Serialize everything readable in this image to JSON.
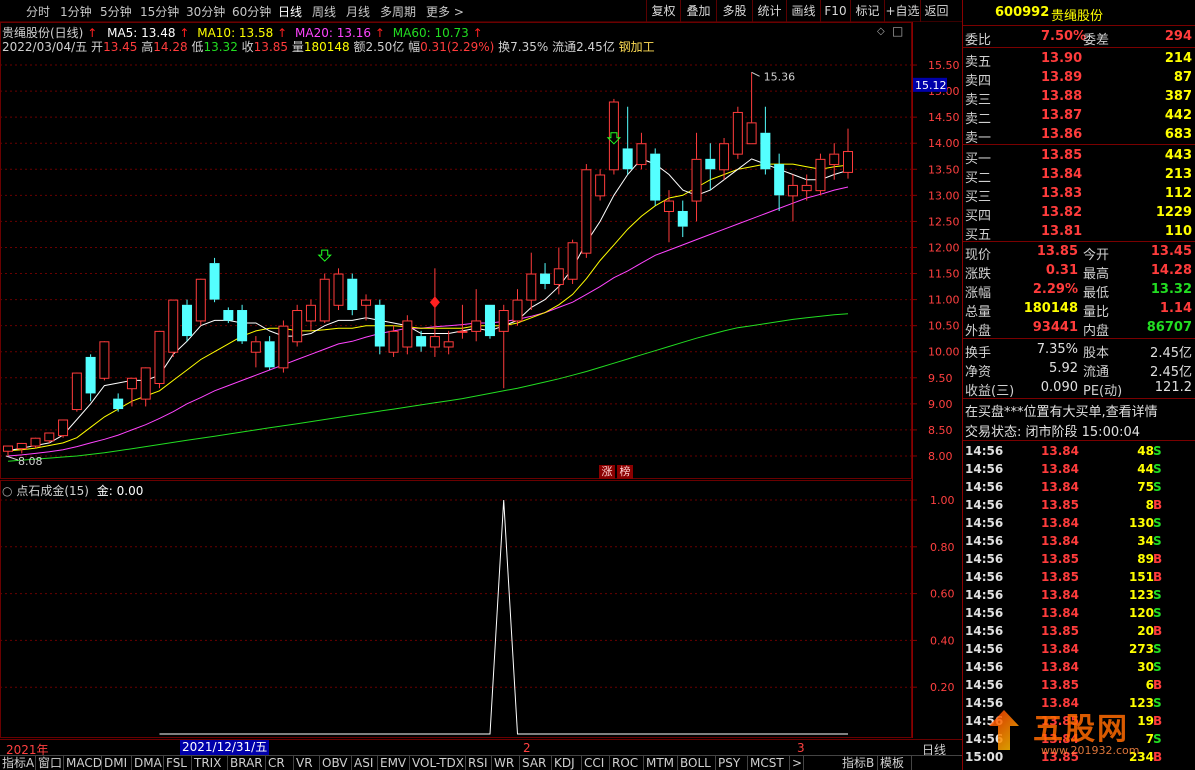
{
  "toolbar": {
    "periods": [
      "分时",
      "1分钟",
      "5分钟",
      "15分钟",
      "30分钟",
      "60分钟",
      "日线",
      "周线",
      "月线",
      "多周期",
      "更多 >"
    ],
    "active_period": "日线",
    "right_buttons": [
      "复权",
      "叠加",
      "多股",
      "统计",
      "画线",
      "F10",
      "标记",
      "+自选",
      "返回"
    ]
  },
  "info": {
    "stock_title": "贵绳股份(日线)",
    "ma5": "MA5: 13.48",
    "ma10": "MA10: 13.58",
    "ma20": "MA20: 13.16",
    "ma60": "MA60: 10.73",
    "date": "2022/03/04/五",
    "open_label": "开",
    "open": "13.45",
    "high_label": "高",
    "high": "14.28",
    "low_label": "低",
    "low": "13.32",
    "close_label": "收",
    "close": "13.85",
    "vol_label": "量",
    "vol": "180148",
    "amount_label": "额",
    "amount": "2.50亿",
    "range_label": "幅",
    "range": "0.31(2.29%)",
    "turnover": "换7.35%",
    "float": "流通2.45亿",
    "sector": "钢加工"
  },
  "colors": {
    "up": "#ff3c3c",
    "down": "#54ffff",
    "ma5": "#ffffff",
    "ma10": "#ffff00",
    "ma20": "#ff44ff",
    "ma60": "#22dd22",
    "grid": "#6a0000"
  },
  "main_axis": {
    "labels": [
      "15.50",
      "15.00",
      "14.50",
      "14.00",
      "13.50",
      "13.00",
      "12.50",
      "12.00",
      "11.50",
      "11.00",
      "10.50",
      "10.00",
      "9.50",
      "9.00",
      "8.50",
      "8.00"
    ],
    "current_price": "15.12",
    "high_mark": "15.36",
    "low_mark": "8.08",
    "min": 7.75,
    "max": 15.75
  },
  "badges": {
    "zhang": "涨",
    "bang": "榜"
  },
  "indicator": {
    "title": "点石成金(15)",
    "value_text": "金: 0.00",
    "axis": [
      "1.00",
      "0.80",
      "0.60",
      "0.40",
      "0.20"
    ]
  },
  "date_axis": {
    "year": "2021年",
    "selected_date": "2021/12/31/五",
    "m2": "2",
    "m3": "3",
    "period": "日线"
  },
  "candles": [
    [
      8.1,
      8.2,
      8.0,
      8.08
    ],
    [
      8.15,
      8.25,
      8.05,
      8.22
    ],
    [
      8.2,
      8.35,
      8.15,
      8.3
    ],
    [
      8.3,
      8.45,
      8.25,
      8.42
    ],
    [
      8.4,
      8.7,
      8.35,
      8.65
    ],
    [
      8.9,
      9.6,
      8.85,
      9.55
    ],
    [
      9.9,
      9.2,
      9.05,
      9.95
    ],
    [
      9.5,
      10.2,
      9.45,
      10.15
    ],
    [
      9.1,
      8.9,
      8.85,
      9.2
    ],
    [
      9.3,
      9.5,
      8.95,
      9.0
    ],
    [
      9.1,
      9.7,
      8.95,
      9.6
    ],
    [
      9.4,
      10.4,
      9.3,
      10.3
    ],
    [
      10.0,
      11.0,
      9.9,
      10.9
    ],
    [
      10.9,
      10.3,
      10.2,
      11.0
    ],
    [
      10.6,
      11.4,
      10.5,
      11.3
    ],
    [
      11.7,
      11.0,
      10.95,
      11.8
    ],
    [
      10.8,
      10.6,
      10.55,
      10.85
    ],
    [
      10.8,
      10.2,
      10.15,
      10.9
    ],
    [
      10.0,
      10.2,
      9.7,
      10.3
    ],
    [
      10.2,
      9.7,
      9.65,
      10.3
    ],
    [
      9.7,
      10.5,
      9.6,
      10.6
    ],
    [
      10.2,
      10.8,
      10.1,
      10.9
    ],
    [
      10.6,
      10.9,
      10.4,
      11.0
    ],
    [
      10.6,
      11.4,
      10.55,
      11.5
    ],
    [
      10.9,
      11.5,
      10.8,
      11.6
    ],
    [
      11.4,
      10.8,
      10.7,
      11.5
    ],
    [
      10.9,
      11.0,
      10.6,
      11.1
    ],
    [
      10.9,
      10.1,
      9.95,
      11.0
    ],
    [
      10.0,
      10.4,
      9.9,
      10.5
    ],
    [
      10.1,
      10.6,
      9.95,
      10.7
    ],
    [
      10.3,
      10.1,
      10.0,
      10.4
    ],
    [
      10.1,
      10.3,
      9.9,
      11.6
    ],
    [
      10.1,
      10.2,
      9.95,
      10.4
    ],
    [
      10.4,
      10.4,
      10.25,
      10.9
    ],
    [
      10.4,
      10.6,
      10.2,
      11.2
    ],
    [
      10.9,
      10.3,
      10.25,
      10.9
    ],
    [
      10.4,
      10.8,
      9.3,
      10.9
    ],
    [
      10.6,
      11.0,
      10.5,
      11.2
    ],
    [
      11.0,
      11.5,
      10.8,
      11.9
    ],
    [
      11.5,
      11.3,
      11.2,
      11.7
    ],
    [
      11.3,
      11.6,
      11.1,
      12.0
    ],
    [
      11.4,
      12.1,
      11.3,
      12.15
    ],
    [
      11.9,
      13.5,
      11.8,
      13.6
    ],
    [
      13.0,
      13.4,
      12.9,
      13.5
    ],
    [
      13.5,
      14.8,
      13.4,
      14.85
    ],
    [
      13.9,
      13.5,
      13.4,
      14.7
    ],
    [
      13.6,
      14.0,
      13.5,
      14.2
    ],
    [
      13.8,
      12.9,
      12.8,
      13.9
    ],
    [
      12.7,
      12.9,
      12.1,
      13.1
    ],
    [
      12.7,
      12.4,
      12.2,
      12.9
    ],
    [
      12.9,
      13.7,
      12.5,
      14.2
    ],
    [
      13.7,
      13.5,
      13.1,
      14.0
    ],
    [
      13.5,
      14.0,
      13.3,
      14.1
    ],
    [
      13.8,
      14.6,
      13.7,
      14.7
    ],
    [
      14.0,
      14.4,
      14.0,
      15.36
    ],
    [
      14.2,
      13.5,
      13.4,
      14.7
    ],
    [
      13.6,
      13.0,
      12.7,
      13.8
    ],
    [
      13.0,
      13.2,
      12.5,
      13.4
    ],
    [
      13.1,
      13.2,
      12.9,
      13.4
    ],
    [
      13.1,
      13.7,
      13.0,
      13.8
    ],
    [
      13.6,
      13.8,
      13.3,
      14.0
    ],
    [
      13.45,
      13.85,
      13.32,
      14.28
    ]
  ],
  "ma5": [
    8.1,
    8.15,
    8.2,
    8.25,
    8.4,
    8.7,
    9.0,
    9.35,
    9.4,
    9.45,
    9.45,
    9.55,
    9.95,
    10.2,
    10.5,
    10.6,
    10.6,
    10.55,
    10.55,
    10.4,
    10.3,
    10.3,
    10.35,
    10.5,
    10.6,
    10.6,
    10.65,
    10.6,
    10.55,
    10.5,
    10.35,
    10.35,
    10.35,
    10.4,
    10.45,
    10.4,
    10.5,
    10.6,
    10.85,
    11.0,
    11.25,
    11.6,
    12.1,
    12.5,
    13.0,
    13.4,
    13.7,
    13.6,
    13.4,
    13.1,
    13.0,
    13.1,
    13.3,
    13.5,
    13.7,
    13.6,
    13.5,
    13.4,
    13.3,
    13.3,
    13.4,
    13.48
  ],
  "ma10": [
    8.1,
    8.12,
    8.15,
    8.2,
    8.25,
    8.35,
    8.55,
    8.75,
    8.9,
    9.05,
    9.15,
    9.25,
    9.45,
    9.65,
    9.85,
    10.0,
    10.15,
    10.3,
    10.4,
    10.45,
    10.45,
    10.4,
    10.4,
    10.42,
    10.45,
    10.45,
    10.5,
    10.5,
    10.5,
    10.48,
    10.45,
    10.45,
    10.45,
    10.45,
    10.5,
    10.5,
    10.5,
    10.55,
    10.65,
    10.75,
    10.9,
    11.1,
    11.4,
    11.75,
    12.05,
    12.35,
    12.6,
    12.8,
    12.95,
    13.0,
    13.15,
    13.3,
    13.4,
    13.5,
    13.55,
    13.6,
    13.6,
    13.6,
    13.55,
    13.5,
    13.55,
    13.58
  ],
  "ma20": [
    8.0,
    8.02,
    8.05,
    8.08,
    8.12,
    8.18,
    8.25,
    8.32,
    8.4,
    8.5,
    8.6,
    8.72,
    8.85,
    9.0,
    9.12,
    9.25,
    9.35,
    9.45,
    9.55,
    9.65,
    9.75,
    9.85,
    9.95,
    10.05,
    10.15,
    10.2,
    10.28,
    10.35,
    10.4,
    10.45,
    10.45,
    10.48,
    10.5,
    10.52,
    10.55,
    10.55,
    10.58,
    10.62,
    10.68,
    10.75,
    10.85,
    10.95,
    11.1,
    11.25,
    11.42,
    11.55,
    11.7,
    11.85,
    11.95,
    12.05,
    12.15,
    12.25,
    12.35,
    12.45,
    12.55,
    12.65,
    12.75,
    12.85,
    12.95,
    13.02,
    13.1,
    13.16
  ],
  "ma60": [
    7.9,
    7.92,
    7.94,
    7.96,
    7.98,
    8.0,
    8.03,
    8.06,
    8.1,
    8.14,
    8.18,
    8.22,
    8.26,
    8.3,
    8.34,
    8.38,
    8.42,
    8.46,
    8.5,
    8.54,
    8.58,
    8.62,
    8.66,
    8.7,
    8.74,
    8.78,
    8.82,
    8.86,
    8.9,
    8.94,
    8.98,
    9.02,
    9.06,
    9.1,
    9.15,
    9.2,
    9.25,
    9.3,
    9.36,
    9.42,
    9.48,
    9.55,
    9.62,
    9.7,
    9.78,
    9.86,
    9.94,
    10.02,
    10.1,
    10.18,
    10.26,
    10.33,
    10.4,
    10.46,
    10.5,
    10.54,
    10.58,
    10.62,
    10.65,
    10.68,
    10.71,
    10.73
  ],
  "quote": {
    "code": "600992",
    "name": "贵绳股份",
    "weibi_label": "委比",
    "weibi": "7.50%",
    "weicha_label": "委差",
    "weicha": "294",
    "sell": [
      {
        "label": "卖五",
        "price": "13.90",
        "vol": "214"
      },
      {
        "label": "卖四",
        "price": "13.89",
        "vol": "87"
      },
      {
        "label": "卖三",
        "price": "13.88",
        "vol": "387"
      },
      {
        "label": "卖二",
        "price": "13.87",
        "vol": "442"
      },
      {
        "label": "卖一",
        "price": "13.86",
        "vol": "683"
      }
    ],
    "buy": [
      {
        "label": "买一",
        "price": "13.85",
        "vol": "443"
      },
      {
        "label": "买二",
        "price": "13.84",
        "vol": "213"
      },
      {
        "label": "买三",
        "price": "13.83",
        "vol": "112"
      },
      {
        "label": "买四",
        "price": "13.82",
        "vol": "1229"
      },
      {
        "label": "买五",
        "price": "13.81",
        "vol": "110"
      }
    ],
    "stats1": [
      {
        "l1": "现价",
        "v1": "13.85",
        "l2": "今开",
        "v2": "13.45",
        "c2": "#ff3c3c",
        "c1": "#ff3c3c"
      },
      {
        "l1": "涨跌",
        "v1": "0.31",
        "l2": "最高",
        "v2": "14.28",
        "c1": "#ff3c3c",
        "c2": "#ff3c3c"
      },
      {
        "l1": "涨幅",
        "v1": "2.29%",
        "l2": "最低",
        "v2": "13.32",
        "c1": "#ff3c3c",
        "c2": "#22dd22"
      },
      {
        "l1": "总量",
        "v1": "180148",
        "l2": "量比",
        "v2": "1.14",
        "c1": "#ffff00",
        "c2": "#ff3c3c"
      },
      {
        "l1": "外盘",
        "v1": "93441",
        "l2": "内盘",
        "v2": "86707",
        "c1": "#ff3c3c",
        "c2": "#22dd22"
      }
    ],
    "stats2": [
      {
        "l1": "换手",
        "v1": "7.35%",
        "l2": "股本",
        "v2": "2.45亿"
      },
      {
        "l1": "净资",
        "v1": "5.92",
        "l2": "流通",
        "v2": "2.45亿"
      },
      {
        "l1": "收益(三)",
        "v1": "0.090",
        "l2": "PE(动)",
        "v2": "121.2"
      }
    ],
    "notice": "在买盘***位置有大买单,查看详情",
    "trade_status": "交易状态: 闭市阶段 15:00:04"
  },
  "ticks": [
    {
      "t": "14:56",
      "p": "13.84",
      "v": "48",
      "s": "S"
    },
    {
      "t": "14:56",
      "p": "13.84",
      "v": "44",
      "s": "S"
    },
    {
      "t": "14:56",
      "p": "13.84",
      "v": "75",
      "s": "S"
    },
    {
      "t": "14:56",
      "p": "13.85",
      "v": "8",
      "s": "B"
    },
    {
      "t": "14:56",
      "p": "13.84",
      "v": "130",
      "s": "S"
    },
    {
      "t": "14:56",
      "p": "13.84",
      "v": "34",
      "s": "S"
    },
    {
      "t": "14:56",
      "p": "13.85",
      "v": "89",
      "s": "B"
    },
    {
      "t": "14:56",
      "p": "13.85",
      "v": "151",
      "s": "B"
    },
    {
      "t": "14:56",
      "p": "13.84",
      "v": "123",
      "s": "S"
    },
    {
      "t": "14:56",
      "p": "13.84",
      "v": "120",
      "s": "S"
    },
    {
      "t": "14:56",
      "p": "13.85",
      "v": "20",
      "s": "B"
    },
    {
      "t": "14:56",
      "p": "13.84",
      "v": "273",
      "s": "S"
    },
    {
      "t": "14:56",
      "p": "13.84",
      "v": "30",
      "s": "S"
    },
    {
      "t": "14:56",
      "p": "13.85",
      "v": "6",
      "s": "B"
    },
    {
      "t": "14:56",
      "p": "13.84",
      "v": "123",
      "s": "S"
    },
    {
      "t": "14:56",
      "p": "13.85",
      "v": "19",
      "s": "B"
    },
    {
      "t": "14:56",
      "p": "13.84",
      "v": "7",
      "s": "S"
    },
    {
      "t": "15:00",
      "p": "13.85",
      "v": "234",
      "s": "B"
    }
  ],
  "watermark": {
    "brand": "五股网",
    "url": "www.201932.com"
  },
  "tabs": [
    "指标A",
    "窗口",
    "MACD",
    "DMI",
    "DMA",
    "FSL",
    "TRIX",
    "BRAR",
    "CR",
    "VR",
    "OBV",
    "ASI",
    "EMV",
    "VOL-TDX",
    "RSI",
    "WR",
    "SAR",
    "KDJ",
    "CCI",
    "ROC",
    "MTM",
    "BOLL",
    "PSY",
    "MCST",
    ">",
    "指标B",
    "模板"
  ]
}
